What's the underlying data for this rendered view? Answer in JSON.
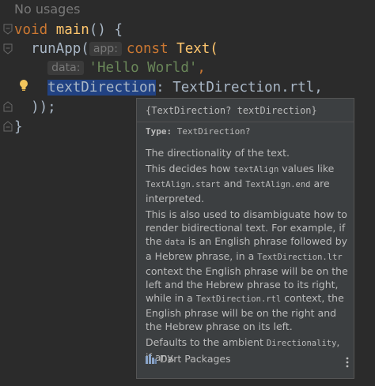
{
  "editor": {
    "usages": "No usages",
    "lines": [
      {
        "keyword": "void",
        "name": "main",
        "rest": "() {"
      },
      {
        "fn": "runApp(",
        "hint": "app:",
        "keyword": "const",
        "cls": "Text("
      },
      {
        "hint": "data:",
        "str": "'Hello World'",
        "rest": ","
      },
      {
        "selected": "textDirection",
        "rest": ": TextDirection.rtl,"
      },
      {
        "text": "));"
      },
      {
        "text": "}"
      }
    ]
  },
  "doc": {
    "signature": "{TextDirection? textDirection}",
    "type_label": "Type:",
    "type_value": "TextDirection?",
    "p1": "The directionality of the text.",
    "p2a": "This decides how ",
    "p2b": "textAlign",
    "p2c": " values like ",
    "p2d": "TextAlign.start",
    "p2e": " and ",
    "p2f": "TextAlign.end",
    "p2g": " are interpreted.",
    "p3a": "This is also used to disambiguate how to render bidirectional text. For example, if the ",
    "p3b": "data",
    "p3c": " is an English phrase followed by a Hebrew phrase, in a ",
    "p3d": "TextDirection.ltr",
    "p3e": " context the English phrase will be on the left and the Hebrew phrase to its right, while in a ",
    "p3f": "TextDirection.rtl",
    "p3g": " context, the English phrase will be on the right and the Hebrew phrase on its left.",
    "p4a": "Defaults to the ambient ",
    "p4b": "Directionality",
    "p4c": ", if any.",
    "footer": "Dart Packages"
  }
}
